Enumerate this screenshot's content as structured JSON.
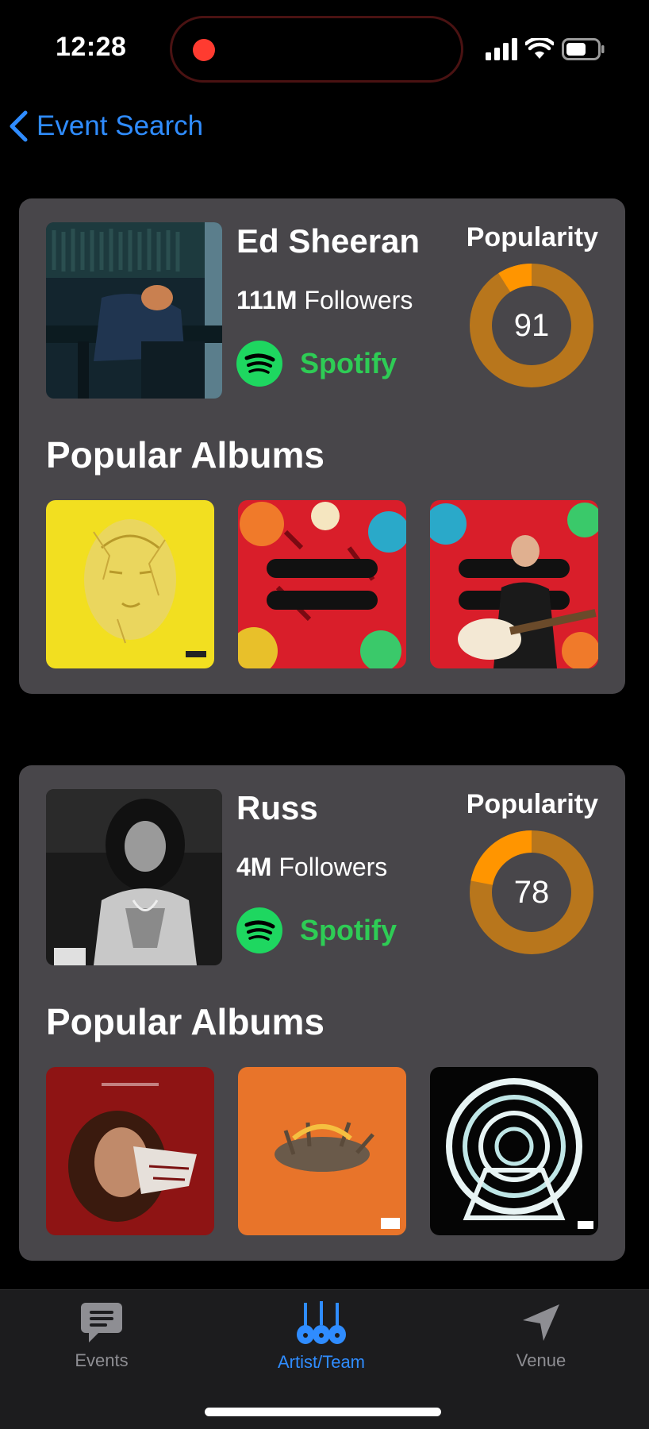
{
  "status_bar": {
    "time": "12:28"
  },
  "nav": {
    "back_label": "Event Search"
  },
  "colors": {
    "accent": "#2f8cff",
    "gauge_fill": "#ff9500",
    "gauge_track": "#b8761c",
    "spotify": "#2ecc55",
    "card_bg": "#48464a"
  },
  "artists": [
    {
      "name": "Ed Sheeran",
      "followers_count": "111M",
      "followers_label": "Followers",
      "link_label": "Spotify",
      "popularity_title": "Popularity",
      "popularity": 91,
      "albums_heading": "Popular Albums"
    },
    {
      "name": "Russ",
      "followers_count": "4M",
      "followers_label": "Followers",
      "link_label": "Spotify",
      "popularity_title": "Popularity",
      "popularity": 78,
      "albums_heading": "Popular Albums"
    }
  ],
  "tabs": [
    {
      "label": "Events",
      "icon": "chat-bubble-icon"
    },
    {
      "label": "Artist/Team",
      "icon": "guitars-icon"
    },
    {
      "label": "Venue",
      "icon": "location-arrow-icon"
    }
  ]
}
